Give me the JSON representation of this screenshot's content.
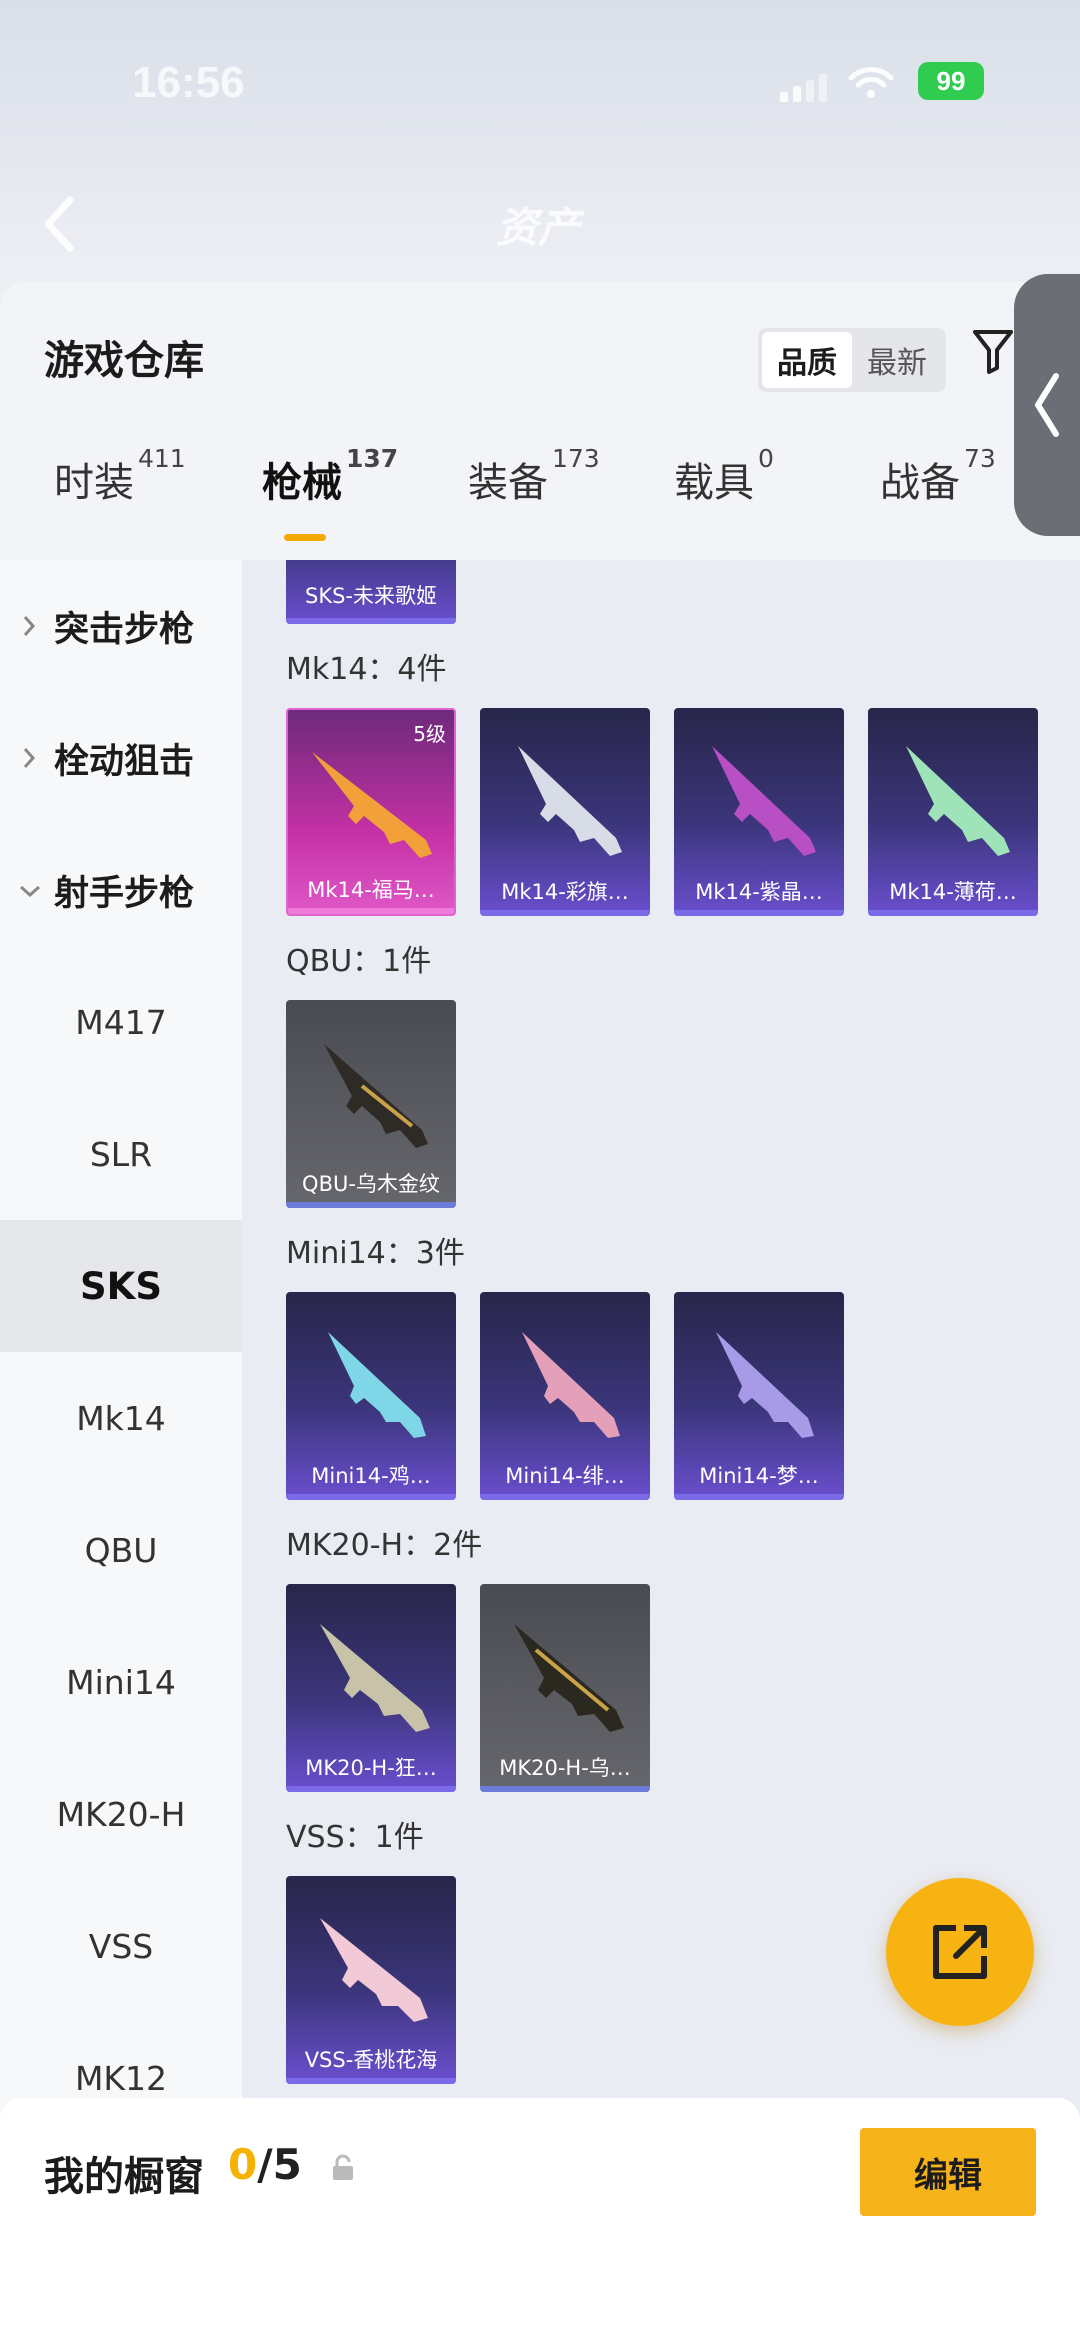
{
  "status": {
    "time": "16:56",
    "battery": "99"
  },
  "nav": {
    "title": "资产"
  },
  "header": {
    "title": "游戏仓库",
    "sort": [
      "品质",
      "最新"
    ]
  },
  "tabs": [
    {
      "label": "时装",
      "count": "411"
    },
    {
      "label": "枪械",
      "count": "137"
    },
    {
      "label": "装备",
      "count": "173"
    },
    {
      "label": "载具",
      "count": "0"
    },
    {
      "label": "战备",
      "count": "73"
    }
  ],
  "sidebar": {
    "parents": [
      "突击步枪",
      "栓动狙击",
      "射手步枪"
    ],
    "items": [
      "M417",
      "SLR",
      "SKS",
      "Mk14",
      "QBU",
      "Mini14",
      "MK20-H",
      "VSS",
      "MK12"
    ]
  },
  "groups": {
    "sks_tail": "SKS-未来歌姬",
    "mk14": {
      "label": "Mk14：4件",
      "items": [
        "Mk14-福马…",
        "Mk14-彩旗…",
        "Mk14-紫晶…",
        "Mk14-薄荷…"
      ],
      "level": "5级"
    },
    "qbu": {
      "label": "QBU：1件",
      "items": [
        "QBU-乌木金纹"
      ]
    },
    "mini14": {
      "label": "Mini14：3件",
      "items": [
        "Mini14-鸡…",
        "Mini14-绯…",
        "Mini14-梦…"
      ]
    },
    "mk20h": {
      "label": "MK20-H：2件",
      "items": [
        "MK20-H-狂…",
        "MK20-H-乌…"
      ]
    },
    "vss": {
      "label": "VSS：1件",
      "items": [
        "VSS-香桃花海"
      ]
    }
  },
  "footer": {
    "label": "我的橱窗",
    "current": "0",
    "total": "/5",
    "edit": "编辑"
  },
  "colors": {
    "accent": "#f5a800",
    "epic": "#6a4fd0",
    "legendary": "#c431a5"
  }
}
